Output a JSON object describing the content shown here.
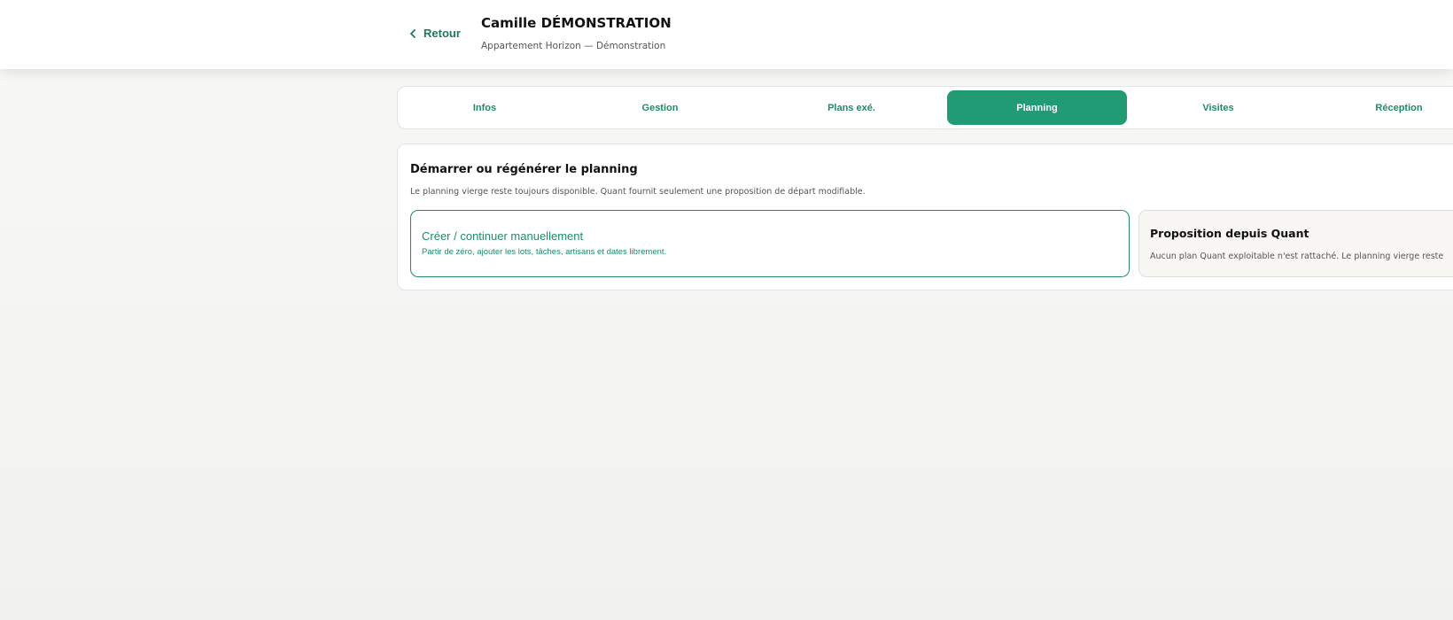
{
  "header": {
    "back_label": "Retour",
    "client_name": "Camille DÉMONSTRATION",
    "project_subtitle": "Appartement Horizon — Démonstration"
  },
  "tabs": [
    {
      "label": "Infos",
      "active": false
    },
    {
      "label": "Gestion",
      "active": false
    },
    {
      "label": "Plans exé.",
      "active": false
    },
    {
      "label": "Planning",
      "active": true
    },
    {
      "label": "Visites",
      "active": false
    },
    {
      "label": "Réception",
      "active": false
    }
  ],
  "planning": {
    "title": "Démarrer ou régénérer le planning",
    "description": "Le planning vierge reste toujours disponible. Quant fournit seulement une proposition de départ modifiable.",
    "options": {
      "manual": {
        "title": "Créer / continuer manuellement",
        "description": "Partir de zéro, ajouter les lots, tâches, artisans et dates librement."
      },
      "quant": {
        "title": "Proposition depuis Quant",
        "description": "Aucun plan Quant exploitable n'est rattaché. Le planning vierge reste"
      }
    }
  },
  "colors": {
    "accent": "#219b74",
    "accent_text": "#1f8c66"
  },
  "icons": {
    "back": "chevron-left-icon"
  }
}
